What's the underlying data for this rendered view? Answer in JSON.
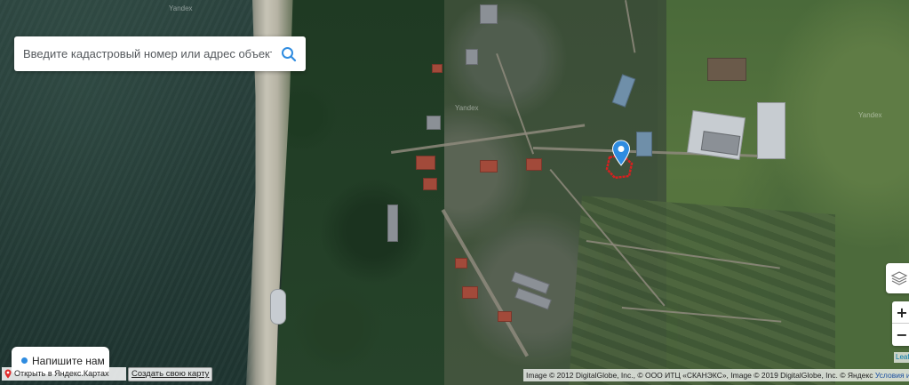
{
  "search": {
    "placeholder": "Введите кадастровый номер или адрес объекта",
    "value": ""
  },
  "map": {
    "type": "satellite",
    "watermarks": [
      "Yandex",
      "Yandex",
      "Yandex"
    ],
    "plot_outline_color": "#d62020",
    "marker_color": "#2f8ce0"
  },
  "controls": {
    "zoom_in": "+",
    "zoom_out": "−",
    "layers_icon": "layers-icon"
  },
  "bottom": {
    "open_in_yandex": "Открыть в Яндекс.Картах",
    "create_map": "Создать свою карту",
    "attribution": "Image © 2012 DigitalGlobe, Inc., © ООО ИТЦ «СКАНЭКС», Image © 2019 DigitalGlobe, Inc. © Яндекс",
    "terms": "Условия использования",
    "leaflet": "Leaflet"
  },
  "chat": {
    "label": "Напишите нам"
  }
}
